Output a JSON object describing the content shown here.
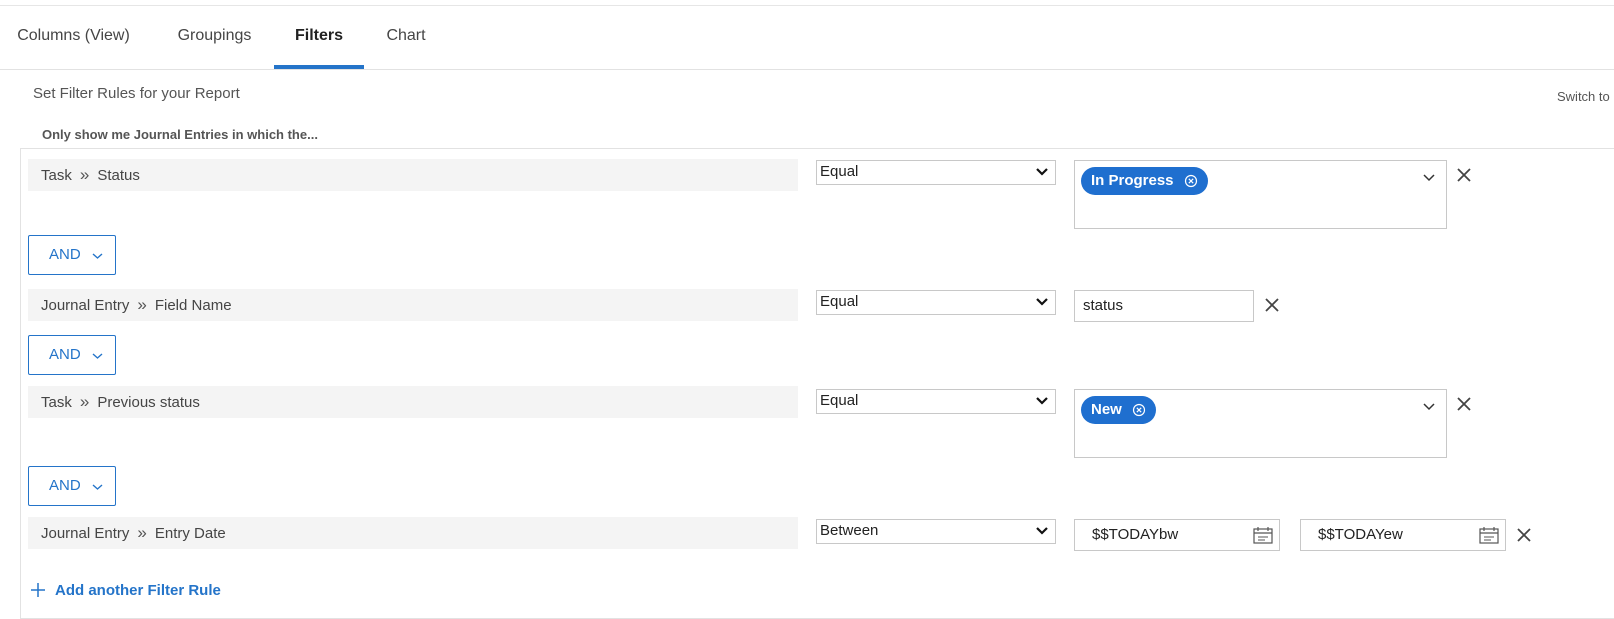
{
  "tabs": [
    {
      "label": "Columns (View)",
      "active": false
    },
    {
      "label": "Groupings",
      "active": false
    },
    {
      "label": "Filters",
      "active": true
    },
    {
      "label": "Chart",
      "active": false
    }
  ],
  "accent_color": "#2474c9",
  "chip_color": "#1f6fcf",
  "panel": {
    "title": "Set Filter Rules for your Report",
    "switch_label": "Switch to",
    "subtitle": "Only show me Journal Entries in which the..."
  },
  "rules": [
    {
      "object": "Task",
      "field": "Status",
      "operator": "Equal",
      "value_type": "multiselect",
      "chips": [
        "In Progress"
      ],
      "connector": "AND"
    },
    {
      "object": "Journal Entry",
      "field": "Field Name",
      "operator": "Equal",
      "value_type": "text",
      "value": "status",
      "connector": "AND"
    },
    {
      "object": "Task",
      "field": "Previous status",
      "operator": "Equal",
      "value_type": "multiselect",
      "chips": [
        "New"
      ],
      "connector": "AND"
    },
    {
      "object": "Journal Entry",
      "field": "Entry Date",
      "operator": "Between",
      "value_type": "date-range",
      "value_from": "$$TODAYbw",
      "value_to": "$$TODAYew"
    }
  ],
  "add_rule_label": "Add another Filter Rule",
  "icons": {
    "breadcrumb": "double-chevron-right-icon",
    "dropdown": "chevron-down-icon",
    "remove": "close-icon",
    "chip_remove": "circle-x-icon",
    "date": "calendar-icon",
    "add": "plus-icon"
  }
}
